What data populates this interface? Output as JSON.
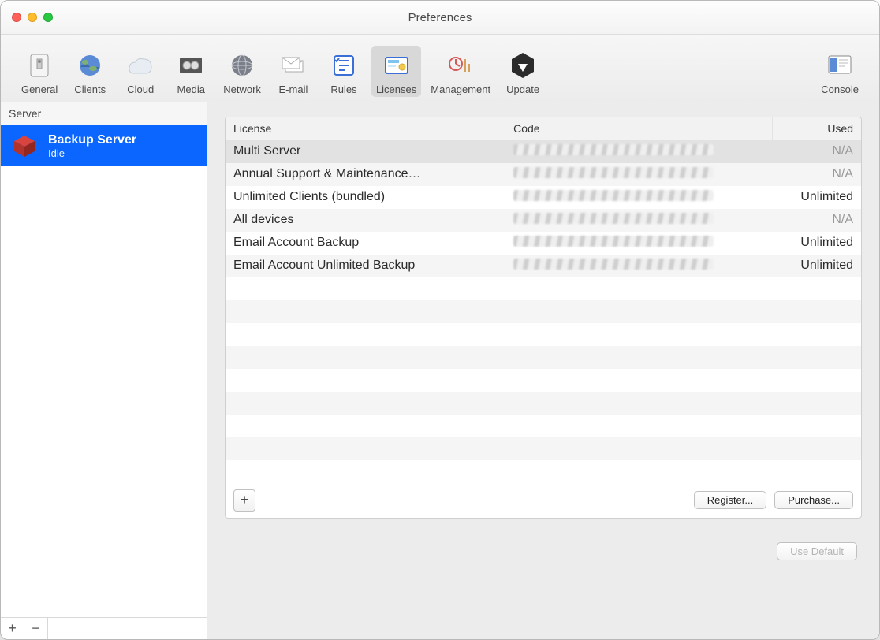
{
  "window": {
    "title": "Preferences"
  },
  "toolbar": {
    "items": [
      {
        "id": "general",
        "label": "General"
      },
      {
        "id": "clients",
        "label": "Clients"
      },
      {
        "id": "cloud",
        "label": "Cloud"
      },
      {
        "id": "media",
        "label": "Media"
      },
      {
        "id": "network",
        "label": "Network"
      },
      {
        "id": "email",
        "label": "E-mail"
      },
      {
        "id": "rules",
        "label": "Rules"
      },
      {
        "id": "licenses",
        "label": "Licenses",
        "selected": true
      },
      {
        "id": "management",
        "label": "Management"
      },
      {
        "id": "update",
        "label": "Update"
      }
    ],
    "right": [
      {
        "id": "console",
        "label": "Console"
      }
    ]
  },
  "sidebar": {
    "heading": "Server",
    "server": {
      "name": "Backup Server",
      "status": "Idle"
    },
    "footer_add": "+",
    "footer_remove": "−"
  },
  "table": {
    "headers": {
      "license": "License",
      "code": "Code",
      "used": "Used"
    },
    "rows": [
      {
        "license": "Multi Server",
        "code": "",
        "used": "N/A",
        "used_na": true,
        "selected": true
      },
      {
        "license": "Annual Support & Maintenance…",
        "code": "",
        "used": "N/A",
        "used_na": true
      },
      {
        "license": "Unlimited Clients (bundled)",
        "code": "",
        "used": "Unlimited"
      },
      {
        "license": "All devices",
        "code": "",
        "used": "N/A",
        "used_na": true
      },
      {
        "license": "Email Account Backup",
        "code": "",
        "used": "Unlimited"
      },
      {
        "license": "Email Account Unlimited Backup",
        "code": "",
        "used": "Unlimited"
      }
    ],
    "empty_rows": 9
  },
  "panel": {
    "add": "+",
    "register": "Register...",
    "purchase": "Purchase..."
  },
  "footer": {
    "use_default": "Use Default"
  }
}
